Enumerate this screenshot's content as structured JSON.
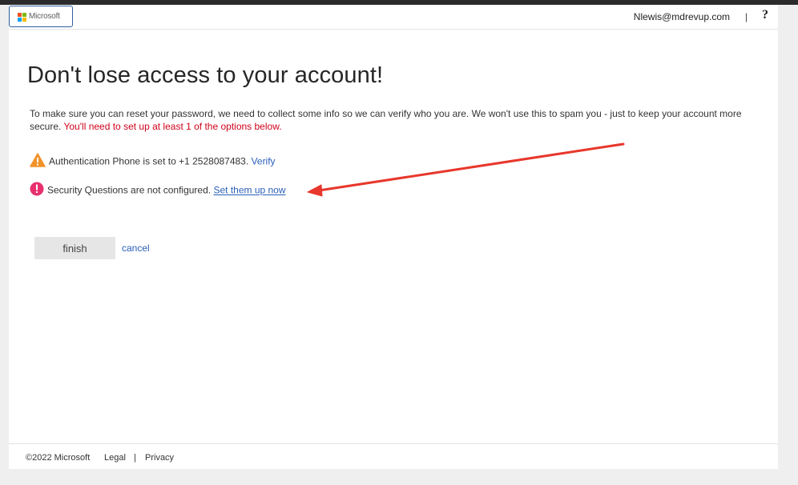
{
  "header": {
    "logo_text": "Microsoft",
    "user_email": "Nlewis@mdrevup.com",
    "separator": "|",
    "help": "?"
  },
  "main": {
    "title": "Don't lose access to your account!",
    "intro_text": "To make sure you can reset your password, we need to collect some info so we can verify who you are. We won't use this to spam you - just to keep your account more secure.",
    "intro_warning": "You'll need to set up at least 1 of the options below.",
    "items": [
      {
        "icon": "warning-triangle-icon",
        "text": "Authentication Phone is set to +1 2528087483.",
        "link": "Verify"
      },
      {
        "icon": "error-exclamation-icon",
        "text": "Security Questions are not configured.",
        "link": "Set them up now"
      }
    ],
    "finish_label": "finish",
    "cancel_label": "cancel"
  },
  "footer": {
    "copyright": "©2022 Microsoft",
    "legal": "Legal",
    "sep": "|",
    "privacy": "Privacy"
  },
  "colors": {
    "warning_red": "#d0021b",
    "link_blue": "#2a5fb8",
    "arrow_red": "#e8372c",
    "triangle_orange": "#f2922a",
    "exclamation_pink": "#e8306e"
  }
}
